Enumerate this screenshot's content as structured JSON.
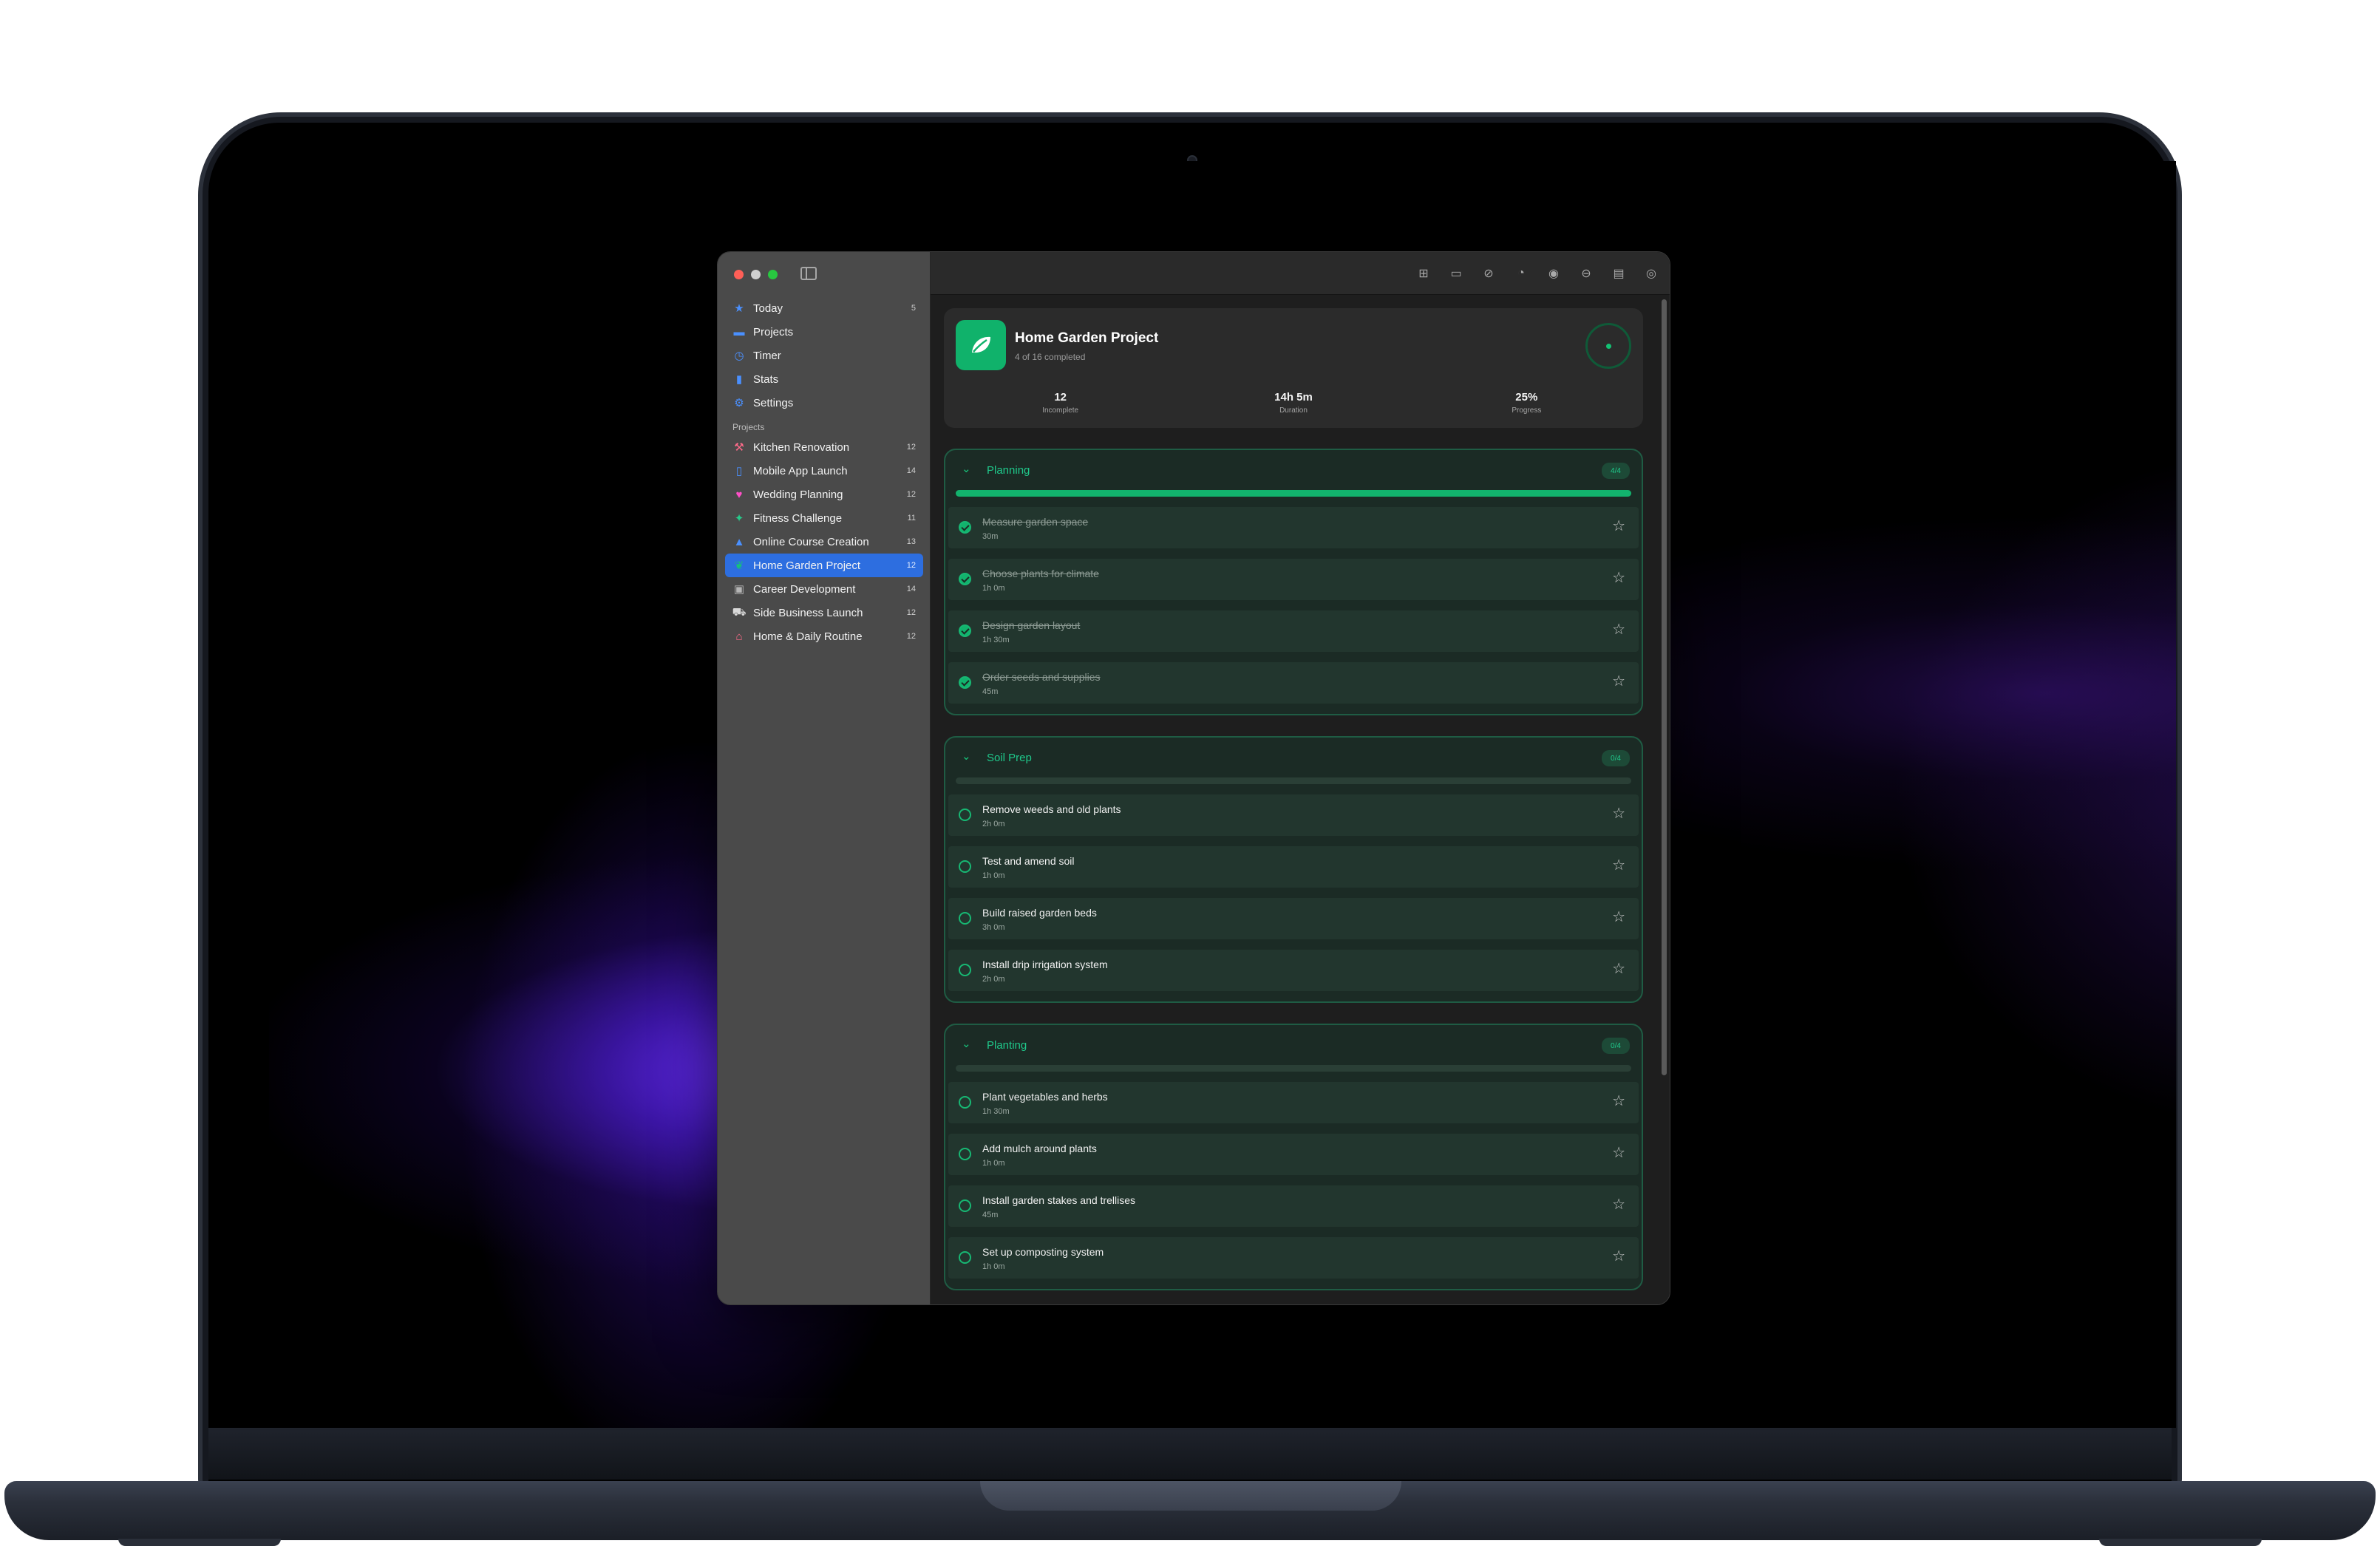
{
  "sidebar": {
    "nav": [
      {
        "label": "Today",
        "count": "5",
        "icon": "star-icon",
        "glyph": "★",
        "color": "#4a90ff"
      },
      {
        "label": "Projects",
        "count": "",
        "icon": "folder-icon",
        "glyph": "▬",
        "color": "#4a90ff"
      },
      {
        "label": "Timer",
        "count": "",
        "icon": "timer-icon",
        "glyph": "◷",
        "color": "#4a90ff"
      },
      {
        "label": "Stats",
        "count": "",
        "icon": "bar-chart-icon",
        "glyph": "▮",
        "color": "#4a90ff"
      },
      {
        "label": "Settings",
        "count": "",
        "icon": "gear-icon",
        "glyph": "⚙",
        "color": "#4a90ff"
      }
    ],
    "projects_label": "Projects",
    "projects": [
      {
        "label": "Kitchen Renovation",
        "count": "12",
        "icon": "hammer-icon",
        "glyph": "⚒",
        "color": "#ff6b8a",
        "active": false
      },
      {
        "label": "Mobile App Launch",
        "count": "14",
        "icon": "phone-icon",
        "glyph": "▯",
        "color": "#4a90ff",
        "active": false
      },
      {
        "label": "Wedding Planning",
        "count": "12",
        "icon": "heart-icon",
        "glyph": "♥",
        "color": "#ff4fc8",
        "active": false
      },
      {
        "label": "Fitness Challenge",
        "count": "11",
        "icon": "runner-icon",
        "glyph": "✦",
        "color": "#27c98a",
        "active": false
      },
      {
        "label": "Online Course Creation",
        "count": "13",
        "icon": "graduation-cap-icon",
        "glyph": "▲",
        "color": "#4a90ff",
        "active": false
      },
      {
        "label": "Home Garden Project",
        "count": "12",
        "icon": "leaf-icon",
        "glyph": "❦",
        "color": "#16c07a",
        "active": true
      },
      {
        "label": "Career Development",
        "count": "14",
        "icon": "briefcase-icon",
        "glyph": "▣",
        "color": "#b5b5b5",
        "active": false
      },
      {
        "label": "Side Business Launch",
        "count": "12",
        "icon": "cart-icon",
        "glyph": "⛟",
        "color": "#d9d9d9",
        "active": false
      },
      {
        "label": "Home & Daily Routine",
        "count": "12",
        "icon": "house-icon",
        "glyph": "⌂",
        "color": "#ff6b8a",
        "active": false
      }
    ]
  },
  "toolbar": {
    "icons": [
      {
        "name": "add-task-icon",
        "glyph": "⊞"
      },
      {
        "name": "new-folder-icon",
        "glyph": "▭"
      },
      {
        "name": "checkmark-circle-icon",
        "glyph": "⊘"
      },
      {
        "name": "timer-reset-icon",
        "glyph": "◔"
      },
      {
        "name": "record-icon",
        "glyph": "◉"
      },
      {
        "name": "minus-circle-icon",
        "glyph": "⊖"
      },
      {
        "name": "archive-icon",
        "glyph": "▤"
      },
      {
        "name": "eye-icon",
        "glyph": "◎"
      }
    ]
  },
  "project": {
    "title": "Home Garden Project",
    "subtitle": "4 of 16 completed",
    "stats": [
      {
        "value": "12",
        "label": "Incomplete"
      },
      {
        "value": "14h 5m",
        "label": "Duration"
      },
      {
        "value": "25%",
        "label": "Progress"
      }
    ],
    "progress": 0.25
  },
  "groups": [
    {
      "title": "Planning",
      "badge": "4/4",
      "progress": 1.0,
      "tasks": [
        {
          "name": "Measure garden space",
          "duration": "30m",
          "done": true
        },
        {
          "name": "Choose plants for climate",
          "duration": "1h 0m",
          "done": true
        },
        {
          "name": "Design garden layout",
          "duration": "1h 30m",
          "done": true
        },
        {
          "name": "Order seeds and supplies",
          "duration": "45m",
          "done": true
        }
      ]
    },
    {
      "title": "Soil Prep",
      "badge": "0/4",
      "progress": 0.0,
      "tasks": [
        {
          "name": "Remove weeds and old plants",
          "duration": "2h 0m",
          "done": false
        },
        {
          "name": "Test and amend soil",
          "duration": "1h 0m",
          "done": false
        },
        {
          "name": "Build raised garden beds",
          "duration": "3h 0m",
          "done": false
        },
        {
          "name": "Install drip irrigation system",
          "duration": "2h 0m",
          "done": false
        }
      ]
    },
    {
      "title": "Planting",
      "badge": "0/4",
      "progress": 0.0,
      "tasks": [
        {
          "name": "Plant vegetables and herbs",
          "duration": "1h 30m",
          "done": false
        },
        {
          "name": "Add mulch around plants",
          "duration": "1h 0m",
          "done": false
        },
        {
          "name": "Install garden stakes and trellises",
          "duration": "45m",
          "done": false
        },
        {
          "name": "Set up composting system",
          "duration": "1h 0m",
          "done": false
        }
      ]
    }
  ],
  "colors": {
    "accent": "#12b36d",
    "selection": "#2d6ee0"
  }
}
